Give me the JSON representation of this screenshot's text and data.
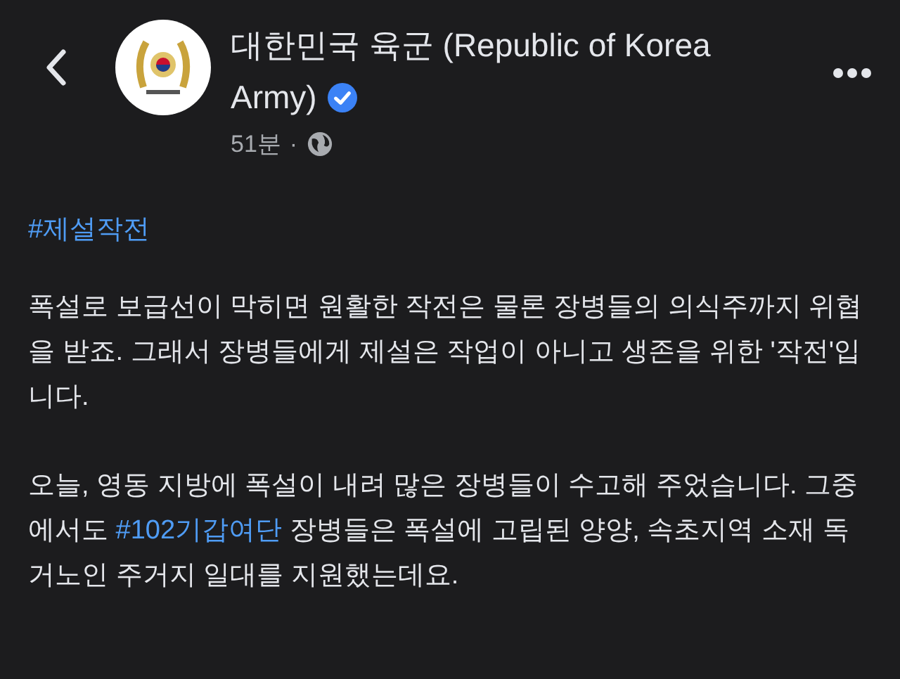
{
  "header": {
    "page_name": "대한민국 육군 (Republic of Korea Army)",
    "verified": true,
    "time": "51분",
    "separator": "·"
  },
  "post": {
    "hashtag": "#제설작전",
    "paragraphs": [
      [
        {
          "kind": "text",
          "text": "폭설로 보급선이 막히면 원활한 작전은 물론 장병들의 의식주까지 위협을 받죠. 그래서 장병들에게 제설은 작업이 아니고 생존을 위한 '작전'입니다."
        }
      ],
      [
        {
          "kind": "text",
          "text": "오늘, 영동 지방에 폭설이 내려 많은 장병들이 수고해 주었습니다. 그중에서도 "
        },
        {
          "kind": "hashtag",
          "text": "#102기갑여단"
        },
        {
          "kind": "text",
          "text": " 장병들은 폭설에 고립된 양양, 속초지역 소재 독거노인 주거지 일대를 지원했는데요."
        }
      ]
    ]
  }
}
